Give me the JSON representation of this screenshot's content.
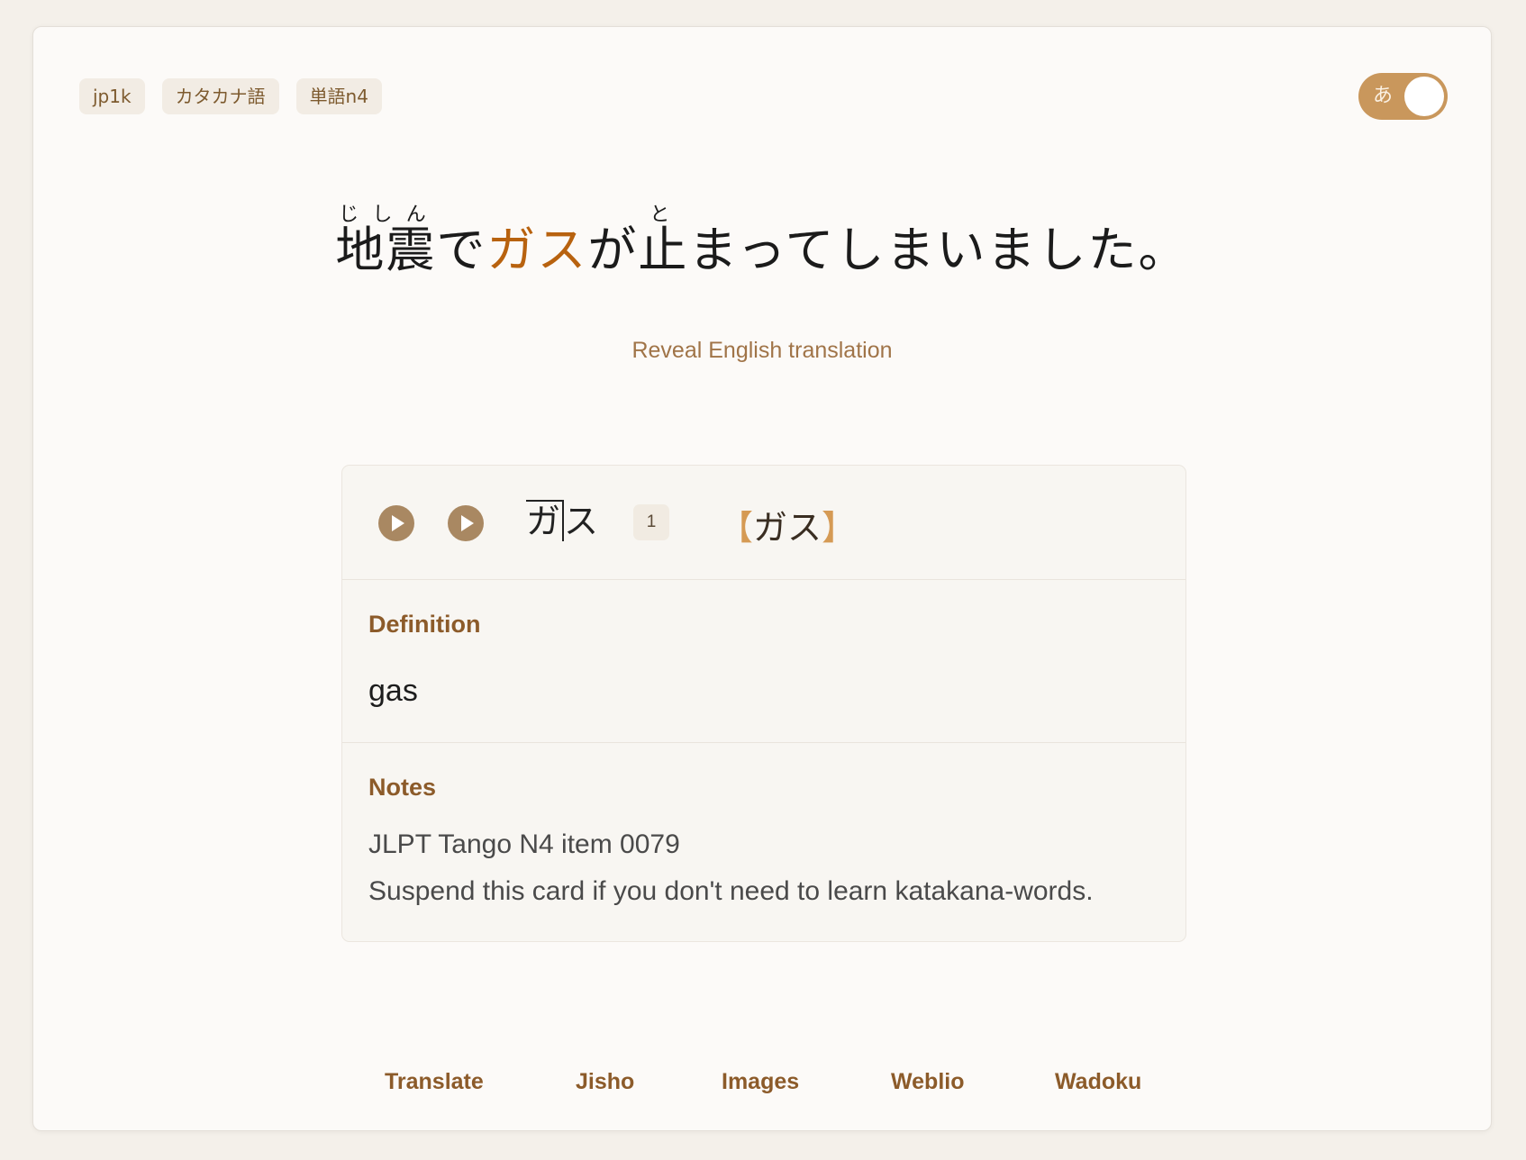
{
  "tags": [
    "jp1k",
    "カタカナ語",
    "単語n4"
  ],
  "toggle": {
    "label": "あ",
    "on": true
  },
  "sentence": {
    "part1_base": "地震",
    "part1_ruby": "じしん",
    "part2": "で",
    "highlight": "ガス",
    "part3": "が",
    "part4_base": "止",
    "part4_ruby": "と",
    "part5": "まってしまいました。"
  },
  "reveal_label": "Reveal English translation",
  "word": {
    "pitch_high": "ガ",
    "pitch_low": "ス",
    "pitch_number": "1",
    "reading_open": "【",
    "reading": "ガス",
    "reading_close": "】"
  },
  "definition": {
    "label": "Definition",
    "text": "gas"
  },
  "notes": {
    "label": "Notes",
    "lines": [
      "JLPT Tango N4 item 0079",
      "Suspend this card if you don't need to learn katakana-words."
    ]
  },
  "links": [
    "Translate",
    "Jisho",
    "Images",
    "Weblio",
    "Wadoku"
  ],
  "icons": {
    "play": "play-icon"
  },
  "colors": {
    "accent": "#b8620f",
    "label": "#8c5b2a",
    "toggle": "#c9975c",
    "play": "#a98862"
  }
}
